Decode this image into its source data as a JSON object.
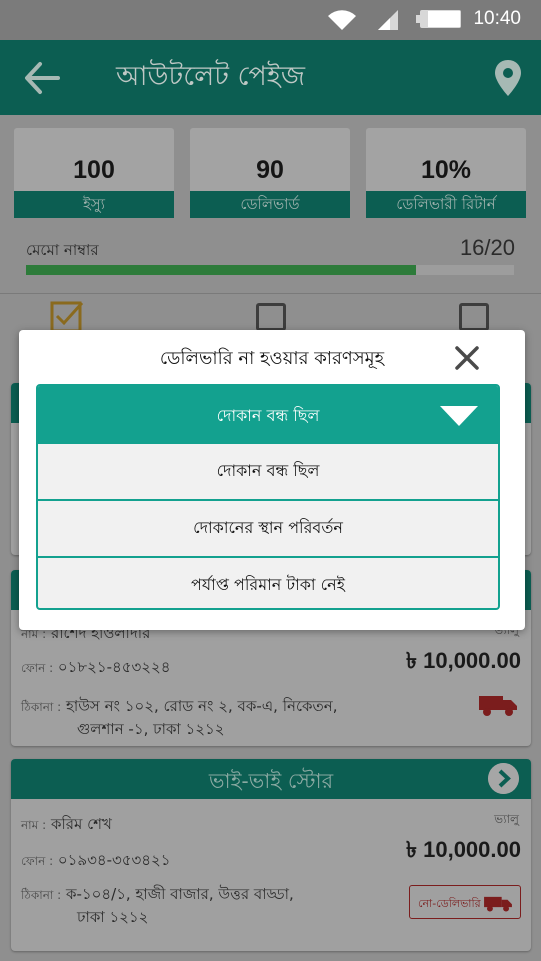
{
  "status_bar": {
    "time": "10:40"
  },
  "app_bar": {
    "title": "আউটলেট পেইজ"
  },
  "stats": [
    {
      "value": "100",
      "label": "ইস্যু"
    },
    {
      "value": "90",
      "label": "ডেলিভার্ড"
    },
    {
      "value": "10%",
      "label": "ডেলিভারী রিটার্ন"
    }
  ],
  "memo": {
    "label": "মেমো নাম্বার",
    "value": "16/20",
    "progress": 0.8
  },
  "cards": [
    {
      "name_label": "নাম :",
      "name": "রাশেদ হাওলাদার",
      "phone_label": "ফোন :",
      "phone": "০১৮২১-৪৫৩২২৪",
      "address_label": "ঠিকানা :",
      "address_line1": "হাউস নং ১০২, রোড নং ২, বক-এ, নিকেতন,",
      "address_line2": "গুলশান -১, ঢাকা ১২১২",
      "value_label": "ভ্যালু",
      "value": "৳ 10,000.00"
    },
    {
      "store": "ভাই-ভাই স্টোর",
      "name_label": "নাম :",
      "name": "করিম শেখ",
      "phone_label": "ফোন :",
      "phone": "০১৯৩৪-৩৫৩৪২১",
      "address_label": "ঠিকানা :",
      "address_line1": "ক-১০৪/১, হাজী বাজার, উত্তর বাড্ডা,",
      "address_line2": "ঢাকা ১২১২",
      "value_label": "ভ্যালু",
      "value": "৳ 10,000.00",
      "action": "নো-ডেলিভারি"
    }
  ],
  "modal": {
    "title": "ডেলিভারি না হওয়ার কারণসমূহ",
    "selected": "দোকান বন্ধ ছিল",
    "options": [
      "দোকান বন্ধ ছিল",
      "দোকানের স্থান পরিবর্তন",
      "পর্যাপ্ত পরিমান টাকা নেই"
    ]
  },
  "colors": {
    "primary": "#13a18f",
    "appbar": "#0c5e52",
    "overlay": "#8f8f8f"
  },
  "icons": [
    "wifi-icon",
    "signal-icon",
    "battery-icon",
    "back-arrow-icon",
    "location-pin-icon",
    "checkbox-icon",
    "chevron-right-icon",
    "truck-icon",
    "close-icon",
    "caret-down-icon"
  ]
}
